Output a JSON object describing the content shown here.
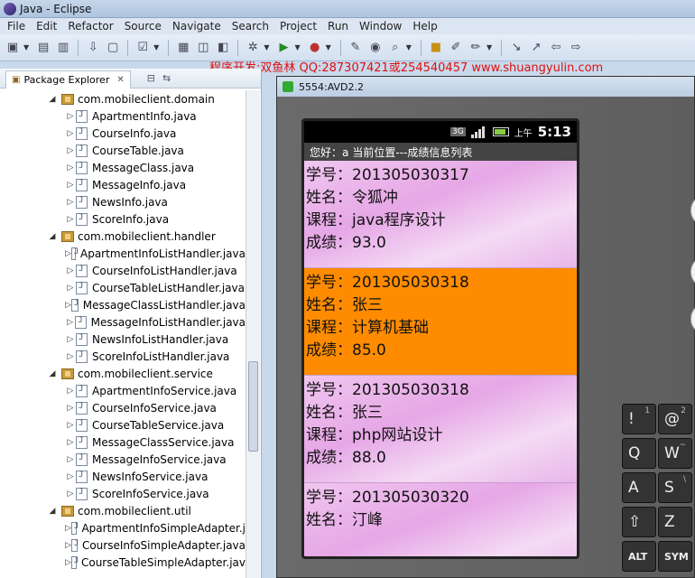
{
  "window": {
    "title": "Java - Eclipse"
  },
  "menu": [
    "File",
    "Edit",
    "Refactor",
    "Source",
    "Navigate",
    "Search",
    "Project",
    "Run",
    "Window",
    "Help"
  ],
  "watermark_text": "程序开发:双鱼林 QQ:287307421或254540457 www.shuangyulin.com",
  "explorer": {
    "tab_label": "Package Explorer",
    "close_glyph": "✕",
    "rows": [
      {
        "type": "pkg",
        "label": "com.mobileclient.domain"
      },
      {
        "type": "file",
        "label": "ApartmentInfo.java"
      },
      {
        "type": "file",
        "label": "CourseInfo.java"
      },
      {
        "type": "file",
        "label": "CourseTable.java"
      },
      {
        "type": "file",
        "label": "MessageClass.java"
      },
      {
        "type": "file",
        "label": "MessageInfo.java"
      },
      {
        "type": "file",
        "label": "NewsInfo.java"
      },
      {
        "type": "file",
        "label": "ScoreInfo.java"
      },
      {
        "type": "pkg",
        "label": "com.mobileclient.handler"
      },
      {
        "type": "file",
        "label": "ApartmentInfoListHandler.java"
      },
      {
        "type": "file",
        "label": "CourseInfoListHandler.java"
      },
      {
        "type": "file",
        "label": "CourseTableListHandler.java"
      },
      {
        "type": "file",
        "label": "MessageClassListHandler.java"
      },
      {
        "type": "file",
        "label": "MessageInfoListHandler.java"
      },
      {
        "type": "file",
        "label": "NewsInfoListHandler.java"
      },
      {
        "type": "file",
        "label": "ScoreInfoListHandler.java"
      },
      {
        "type": "pkg",
        "label": "com.mobileclient.service"
      },
      {
        "type": "file",
        "label": "ApartmentInfoService.java"
      },
      {
        "type": "file",
        "label": "CourseInfoService.java"
      },
      {
        "type": "file",
        "label": "CourseTableService.java"
      },
      {
        "type": "file",
        "label": "MessageClassService.java"
      },
      {
        "type": "file",
        "label": "MessageInfoService.java"
      },
      {
        "type": "file",
        "label": "NewsInfoService.java"
      },
      {
        "type": "file",
        "label": "ScoreInfoService.java"
      },
      {
        "type": "pkg",
        "label": "com.mobileclient.util"
      },
      {
        "type": "file",
        "label": "ApartmentInfoSimpleAdapter.j"
      },
      {
        "type": "file",
        "label": "CourseInfoSimpleAdapter.java"
      },
      {
        "type": "file",
        "label": "CourseTableSimpleAdapter.jav"
      }
    ]
  },
  "emulator": {
    "title": "5554:AVD2.2",
    "status": {
      "network": "3G",
      "ampm": "上午",
      "time": "5:13"
    },
    "header": {
      "greeting": "您好：a",
      "location": "当前位置---成绩信息列表"
    },
    "items": [
      {
        "id_line": "学号：201305030317",
        "name_line": "姓名：令狐冲",
        "course_line": "课程：java程序设计",
        "score_line": "成绩：93.0",
        "selected": false
      },
      {
        "id_line": "学号：201305030318",
        "name_line": "姓名：张三",
        "course_line": "课程：计算机基础",
        "score_line": "成绩：85.0",
        "selected": true
      },
      {
        "id_line": "学号：201305030318",
        "name_line": "姓名：张三",
        "course_line": "课程：php网站设计",
        "score_line": "成绩：88.0",
        "selected": false
      },
      {
        "id_line": "学号：201305030320",
        "name_line": "姓名：汀峰",
        "course_line": "",
        "score_line": "",
        "selected": false
      }
    ],
    "keys": [
      {
        "label": "!",
        "sup": "1"
      },
      {
        "label": "@",
        "sup": "2"
      },
      {
        "label": "Q",
        "sup": ""
      },
      {
        "label": "W",
        "sup": "~"
      },
      {
        "label": "A",
        "sup": ""
      },
      {
        "label": "S",
        "sup": "\\"
      },
      {
        "label": "⇧",
        "sup": ""
      },
      {
        "label": "Z",
        "sup": ""
      },
      {
        "label": "ALT",
        "sup": ""
      },
      {
        "label": "SYM",
        "sup": ""
      }
    ]
  },
  "colors": {
    "selected_row": "#ff8c00",
    "watermark": "#dd1111",
    "list_bg": "#e6a7e6"
  }
}
